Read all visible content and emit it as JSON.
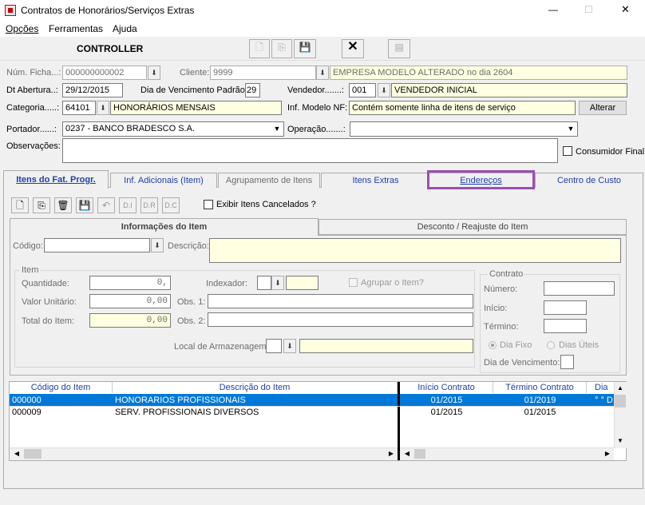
{
  "window": {
    "title": "Contratos de Honorários/Serviços Extras",
    "min": "—",
    "max": "☐",
    "close": "✕"
  },
  "menu": [
    "Opções",
    "Ferramentas",
    "Ajuda"
  ],
  "header": {
    "controller": "CONTROLLER"
  },
  "fields": {
    "ficha_label": "Núm. Ficha...:",
    "ficha_value": "000000000002",
    "cliente_label": "Cliente:",
    "cliente_code": "9999",
    "cliente_name": "EMPRESA MODELO ALTERADO no dia 2604",
    "abertura_label": "Dt Abertura..:",
    "abertura_value": "29/12/2015",
    "vencimento_label": "Dia de Vencimento Padrão:",
    "vencimento_value": "29",
    "vendedor_label": "Vendedor.......:",
    "vendedor_code": "001",
    "vendedor_name": "VENDEDOR INICIAL",
    "categoria_label": "Categoria.....:",
    "categoria_code": "64101",
    "categoria_name": "HONORÁRIOS MENSAIS",
    "modelo_label": "Inf. Modelo NF:",
    "modelo_value": "Contém somente linha de itens de serviço",
    "alterar_label": "Alterar",
    "portador_label": "Portador......:",
    "portador_value": "0237 - BANCO BRADESCO S.A.",
    "operacao_label": "Operação.......:",
    "operacao_value": "",
    "obs_label": "Observações:",
    "obs_value": "",
    "consumidor_label": "Consumidor Final"
  },
  "tabs": [
    "Itens do Fat. Progr.",
    "Inf. Adicionais (Item)",
    "Agrupamento de Itens",
    "Itens Extras",
    "Endereços",
    "Centro de Custo"
  ],
  "subtoolbar": {
    "di": "D.I",
    "dr": "D.R",
    "dc": "D.C",
    "exibir_label": "Exibir Itens Cancelados ?"
  },
  "subtabs": [
    "Informações do Item",
    "Desconto / Reajuste do Item"
  ],
  "item": {
    "codigo_label": "Código:",
    "descricao_label": "Descrição:",
    "group_label": "Item",
    "quantidade_label": "Quantidade:",
    "quantidade_value": "0,",
    "indexador_label": "Indexador:",
    "agrupar_label": "Agrupar o Item?",
    "valor_label": "Valor Unitário:",
    "valor_value": "0,00",
    "obs1_label": "Obs. 1:",
    "total_label": "Total do Item:",
    "total_value": "0,00",
    "obs2_label": "Obs. 2:",
    "local_label": "Local de Armazenagem:"
  },
  "contrato": {
    "group_label": "Contrato",
    "numero_label": "Número:",
    "inicio_label": "Início:",
    "termino_label": "Término:",
    "dia_fixo": "Dia Fixo",
    "dias_uteis": "Dias Úteis",
    "dia_venc_label": "Dia de Vencimento:"
  },
  "grid": {
    "columns": [
      "Código do Item",
      "Descrição do Item",
      "Início Contrato",
      "Término Contrato",
      "Dia V"
    ],
    "rows": [
      {
        "codigo": "000000",
        "descricao": "HONORARIOS PROFISSIONAIS",
        "inicio": "01/2015",
        "termino": "01/2019",
        "dia": "° ° D"
      },
      {
        "codigo": "000009",
        "descricao": "SERV. PROFISSIONAIS DIVERSOS",
        "inicio": "01/2015",
        "termino": "01/2015",
        "dia": ""
      }
    ]
  },
  "colors": {
    "highlight": "#9b4fb0",
    "selection": "#0078d7",
    "yellow": "#ffffe1",
    "link": "#1e3fa8"
  }
}
